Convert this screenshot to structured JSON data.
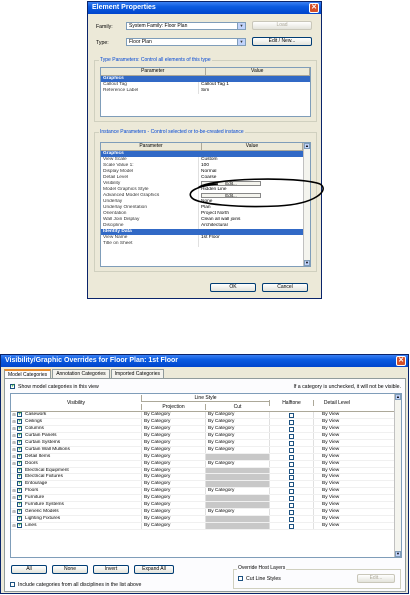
{
  "element_properties": {
    "title": "Element Properties",
    "family_label": "Family:",
    "family_value": "System Family: Floor Plan",
    "type_label": "Type:",
    "type_value": "Floor Plan",
    "load_button": "Load",
    "edit_new_button": "Edit / New...",
    "type_params_title": "Type Parameters: Control all elements of this type",
    "col_parameter": "Parameter",
    "col_value": "Value",
    "type_params": [
      {
        "name": "Graphics",
        "value": "",
        "section": true
      },
      {
        "name": "Callout Tag",
        "value": "Callout Tag 1"
      },
      {
        "name": "Reference Label",
        "value": "Sim"
      }
    ],
    "instance_params_title": "Instance Parameters - Control selected or to-be-created instance",
    "instance_params": [
      {
        "name": "Graphics",
        "value": "",
        "section": true
      },
      {
        "name": "View Scale",
        "value": "Custom"
      },
      {
        "name": "Scale Value    1:",
        "value": "100"
      },
      {
        "name": "Display Model",
        "value": "Normal"
      },
      {
        "name": "Detail Level",
        "value": "Coarse"
      },
      {
        "name": "Visibility",
        "value": "Edit...",
        "button": true
      },
      {
        "name": "Model Graphics Style",
        "value": "Hidden Line"
      },
      {
        "name": "Advanced Model Graphics",
        "value": "Edit...",
        "button": true
      },
      {
        "name": "Underlay",
        "value": "None"
      },
      {
        "name": "Underlay Orientation",
        "value": "Plan"
      },
      {
        "name": "Orientation",
        "value": "Project North"
      },
      {
        "name": "Wall Join Display",
        "value": "Clean all wall joins"
      },
      {
        "name": "Discipline",
        "value": "Architectural"
      },
      {
        "name": "Identity Data",
        "value": "",
        "section": true
      },
      {
        "name": "View Name",
        "value": "1st Floor"
      },
      {
        "name": "Title on Sheet",
        "value": ""
      }
    ],
    "ok_button": "OK",
    "cancel_button": "Cancel"
  },
  "vg_overrides": {
    "title": "Visibility/Graphic Overrides for Floor Plan: 1st Floor",
    "tabs": [
      "Model Categories",
      "Annotation Categories",
      "Imported Categories"
    ],
    "show_model_label": "Show model categories in this view",
    "unchecked_note": "If a category is unchecked, it will not be visible.",
    "col_visibility": "Visibility",
    "col_line_style": "Line Style",
    "col_projection": "Projection",
    "col_cut": "Cut",
    "col_halftone": "Halftone",
    "col_detail_level": "Detail Level",
    "rows": [
      {
        "name": "Casework",
        "proj": "By Category",
        "cut": "By Category",
        "det": "By View",
        "exp": true
      },
      {
        "name": "Ceilings",
        "proj": "By Category",
        "cut": "By Category",
        "det": "By View",
        "exp": true
      },
      {
        "name": "Columns",
        "proj": "By Category",
        "cut": "By Category",
        "det": "By View",
        "exp": true
      },
      {
        "name": "Curtain Panels",
        "proj": "By Category",
        "cut": "By Category",
        "det": "By View",
        "exp": true
      },
      {
        "name": "Curtain Systems",
        "proj": "By Category",
        "cut": "By Category",
        "det": "By View",
        "exp": true
      },
      {
        "name": "Curtain Wall Mullions",
        "proj": "By Category",
        "cut": "By Category",
        "det": "By View",
        "exp": true
      },
      {
        "name": "Detail Items",
        "proj": "By Category",
        "cut": "",
        "det": "By View",
        "exp": true
      },
      {
        "name": "Doors",
        "proj": "By Category",
        "cut": "By Category",
        "det": "By View",
        "exp": true
      },
      {
        "name": "Electrical Equipment",
        "proj": "By Category",
        "cut": "",
        "det": "By View",
        "exp": false
      },
      {
        "name": "Electrical Fixtures",
        "proj": "By Category",
        "cut": "",
        "det": "By View",
        "exp": false
      },
      {
        "name": "Entourage",
        "proj": "By Category",
        "cut": "",
        "det": "By View",
        "exp": false
      },
      {
        "name": "Floors",
        "proj": "By Category",
        "cut": "By Category",
        "det": "By View",
        "exp": true
      },
      {
        "name": "Furniture",
        "proj": "By Category",
        "cut": "",
        "det": "By View",
        "exp": true
      },
      {
        "name": "Furniture Systems",
        "proj": "By Category",
        "cut": "",
        "det": "By View",
        "exp": false
      },
      {
        "name": "Generic Models",
        "proj": "By Category",
        "cut": "By Category",
        "det": "By View",
        "exp": true
      },
      {
        "name": "Lighting Fixtures",
        "proj": "By Category",
        "cut": "",
        "det": "By View",
        "exp": false
      },
      {
        "name": "Lines",
        "proj": "By Category",
        "cut": "",
        "det": "By View",
        "exp": true
      }
    ],
    "all_button": "All",
    "none_button": "None",
    "invert_button": "Invert",
    "expand_all_button": "Expand All",
    "override_host_label": "Override Host Layers",
    "cut_line_styles_label": "Cut Line Styles",
    "edit_button": "Edit...",
    "include_categories_label": "Include categories from all disciplines in the list above"
  }
}
